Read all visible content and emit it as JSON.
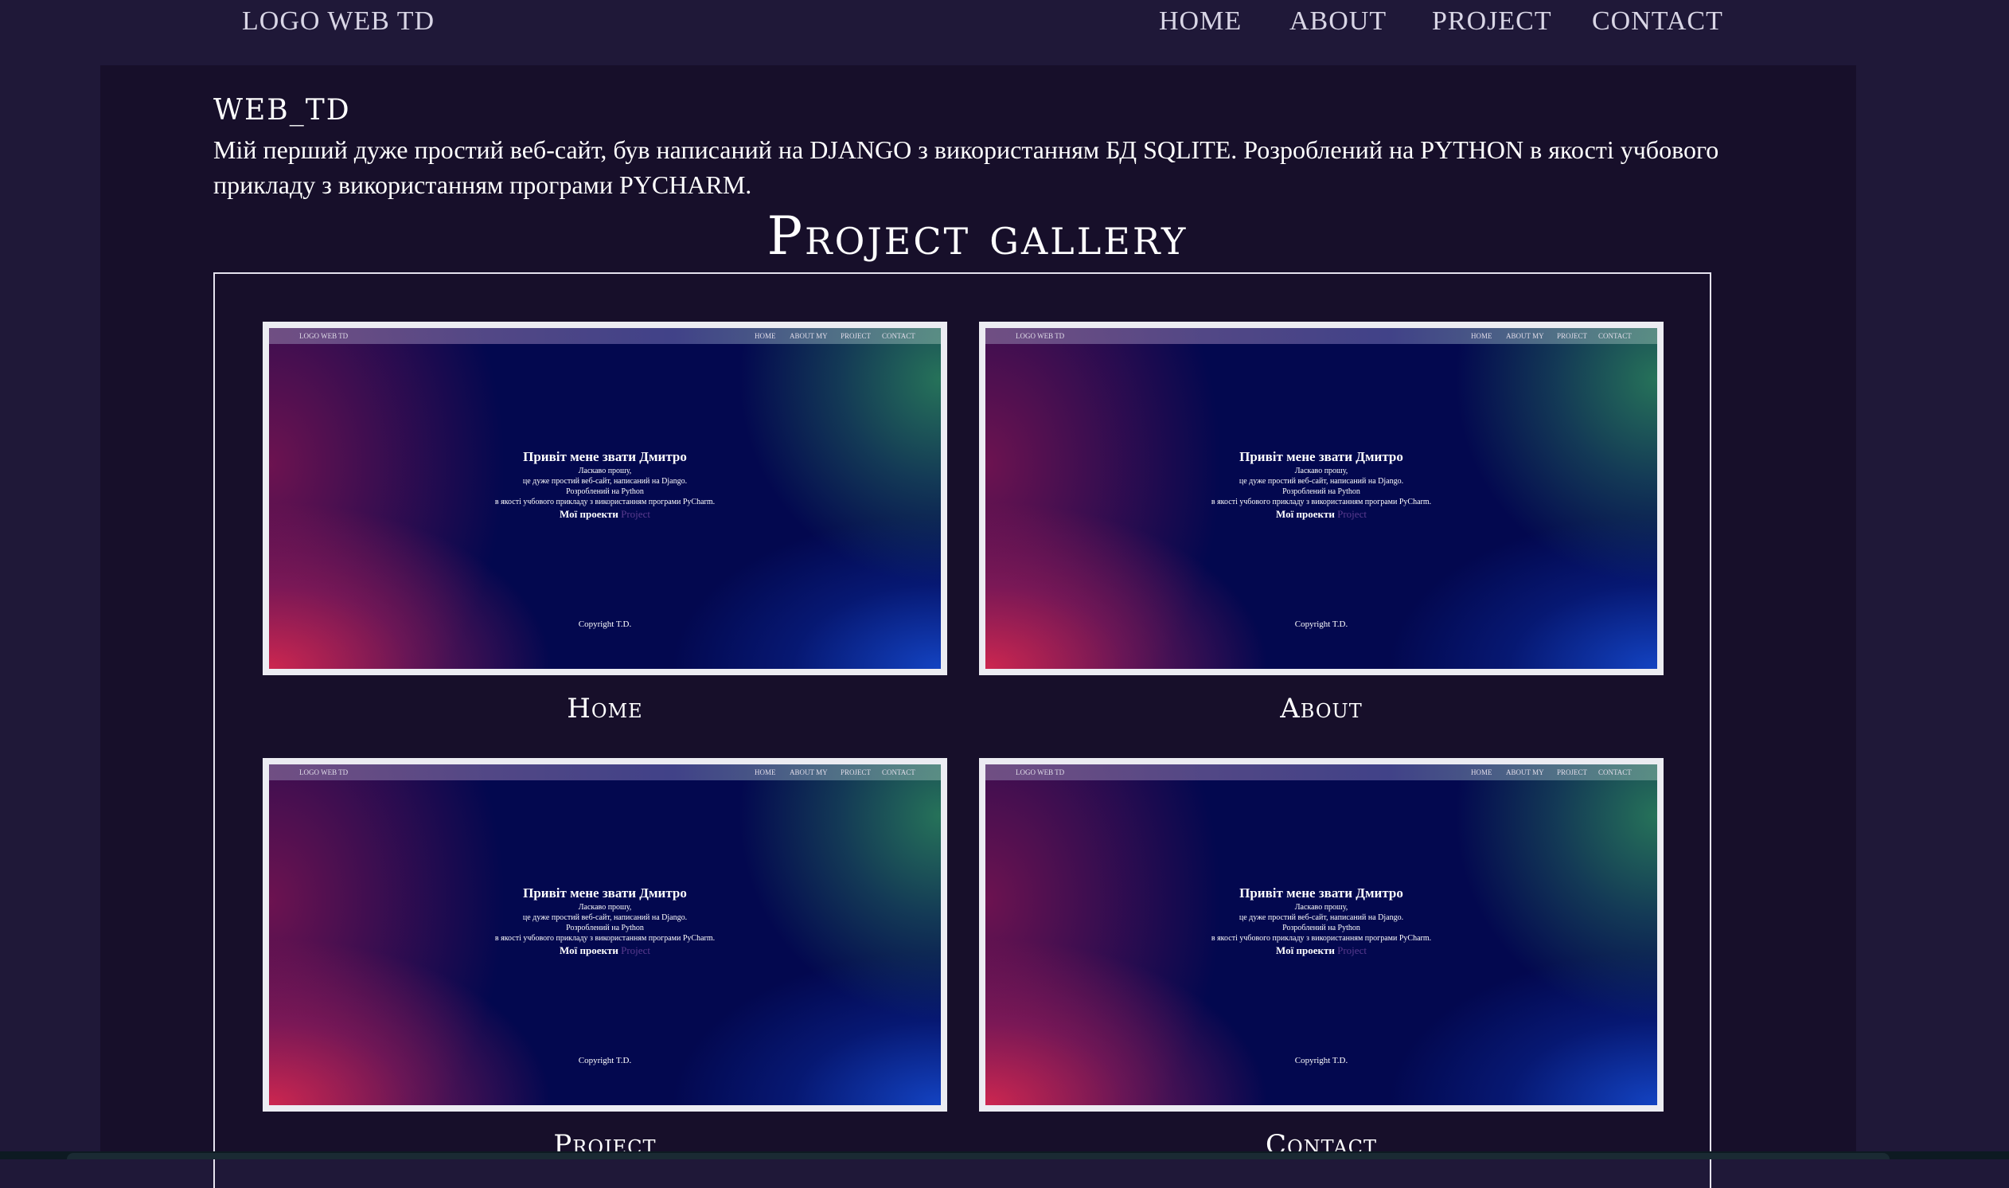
{
  "header": {
    "logo": "LOGO WEB TD",
    "nav": [
      {
        "label": "HOME"
      },
      {
        "label": "ABOUT"
      },
      {
        "label": "PROJECT"
      },
      {
        "label": "CONTACT"
      }
    ]
  },
  "main": {
    "site_name": "WEB_TD",
    "intro": "Мій перший дуже простий веб-сайт, був написаний на DJANGO з використанням БД SQLITE. Розроблений на PYTHON в якості учбового прикладу з використанням програми PYCHARM.",
    "gallery_title": "Project gallery"
  },
  "thumbnail": {
    "logo": "LOGO WEB TD",
    "nav": [
      "HOME",
      "ABOUT MY",
      "PROJECT",
      "CONTACT"
    ],
    "heading": "Привіт мене звати Дмитро",
    "lines": [
      "Ласкаво прошу,",
      "це дуже простий веб-сайт, написаний на Django.",
      "Розроблений на Python",
      "в якості учбового прикладу з використанням програми PyCharm."
    ],
    "projects_label": "Мої проекти",
    "projects_link": "Project",
    "copyright": "Copyright T.D."
  },
  "gallery": [
    {
      "caption": "Home"
    },
    {
      "caption": "About"
    },
    {
      "caption": "Project"
    },
    {
      "caption": "Contact"
    }
  ]
}
